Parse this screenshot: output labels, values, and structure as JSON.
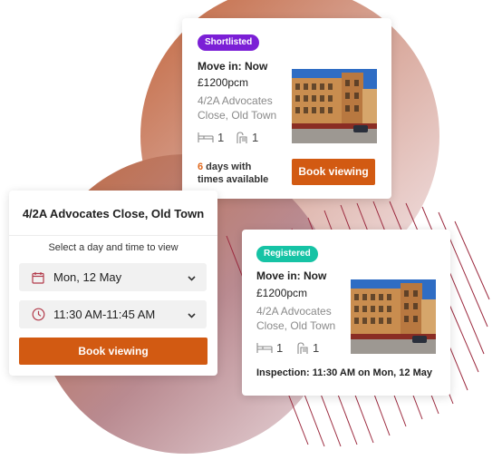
{
  "colors": {
    "accent": "#d25a12",
    "shortlisted_badge": "#7b1fd6",
    "registered_badge": "#16c3a5",
    "days_highlight": "#e0661a"
  },
  "shortlisted_card": {
    "badge": "Shortlisted",
    "move_in": "Move in: Now",
    "price": "£1200pcm",
    "address_line1": "4/2A Advocates",
    "address_line2": "Close, Old Town",
    "beds": "1",
    "baths": "1",
    "days_count": "6",
    "days_text_1": " days with",
    "days_text_2": "times available",
    "button": "Book viewing"
  },
  "booking_form": {
    "title": "4/2A Advocates Close, Old Town",
    "prompt": "Select a day and time to view",
    "date_value": "Mon, 12 May",
    "time_value": "11:30 AM-11:45 AM",
    "button": "Book viewing",
    "date_icon": "calendar-icon",
    "time_icon": "clock-icon"
  },
  "registered_card": {
    "badge": "Registered",
    "move_in": "Move in: Now",
    "price": "£1200pcm",
    "address_line1": "4/2A Advocates",
    "address_line2": "Close, Old Town",
    "beds": "1",
    "baths": "1",
    "inspection": "Inspection: 11:30 AM on Mon, 12 May"
  }
}
